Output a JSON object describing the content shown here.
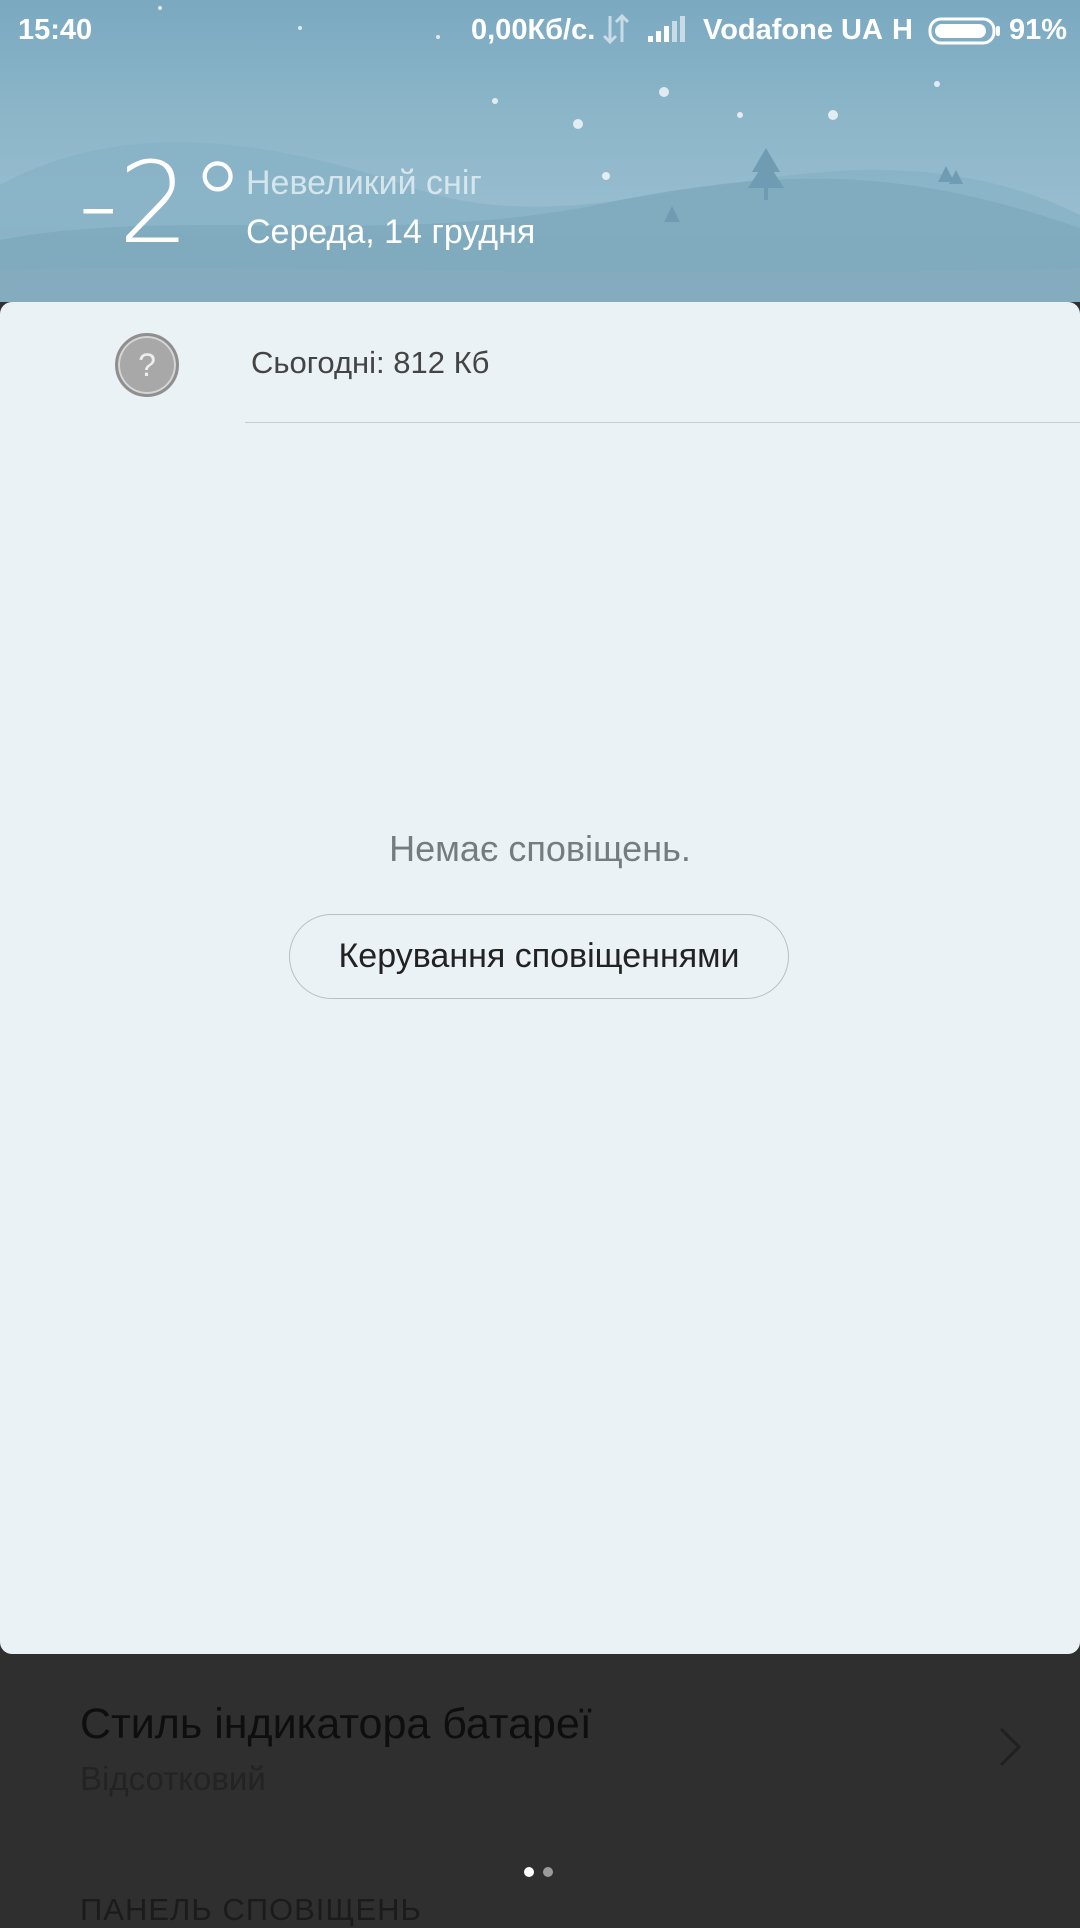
{
  "status_bar": {
    "time": "15:40",
    "net_speed": "0,00Кб/с.",
    "carrier": "Vodafone UA",
    "network_type": "H",
    "battery_percent": "91%",
    "battery_level": 0.91
  },
  "weather": {
    "temperature": "-2°",
    "condition": "Невеликий сніг",
    "date": "Середа, 14 грудня"
  },
  "data_usage": {
    "icon": "question-icon",
    "icon_glyph": "?",
    "label": "Сьогодні: 812 Кб"
  },
  "notifications": {
    "empty_text": "Немає сповіщень.",
    "manage_button": "Керування сповіщеннями"
  },
  "background_settings": {
    "item_title": "Стиль індикатора батареї",
    "item_value": "Відсотковий",
    "section_header": "ПАНЕЛЬ СПОВІЩЕНЬ"
  },
  "pager": {
    "pages": 2,
    "active": 1
  },
  "colors": {
    "panel_bg": "#eaf2f5",
    "header_bg": "#8db6c9",
    "scrim_bg": "#2f2f2f"
  }
}
